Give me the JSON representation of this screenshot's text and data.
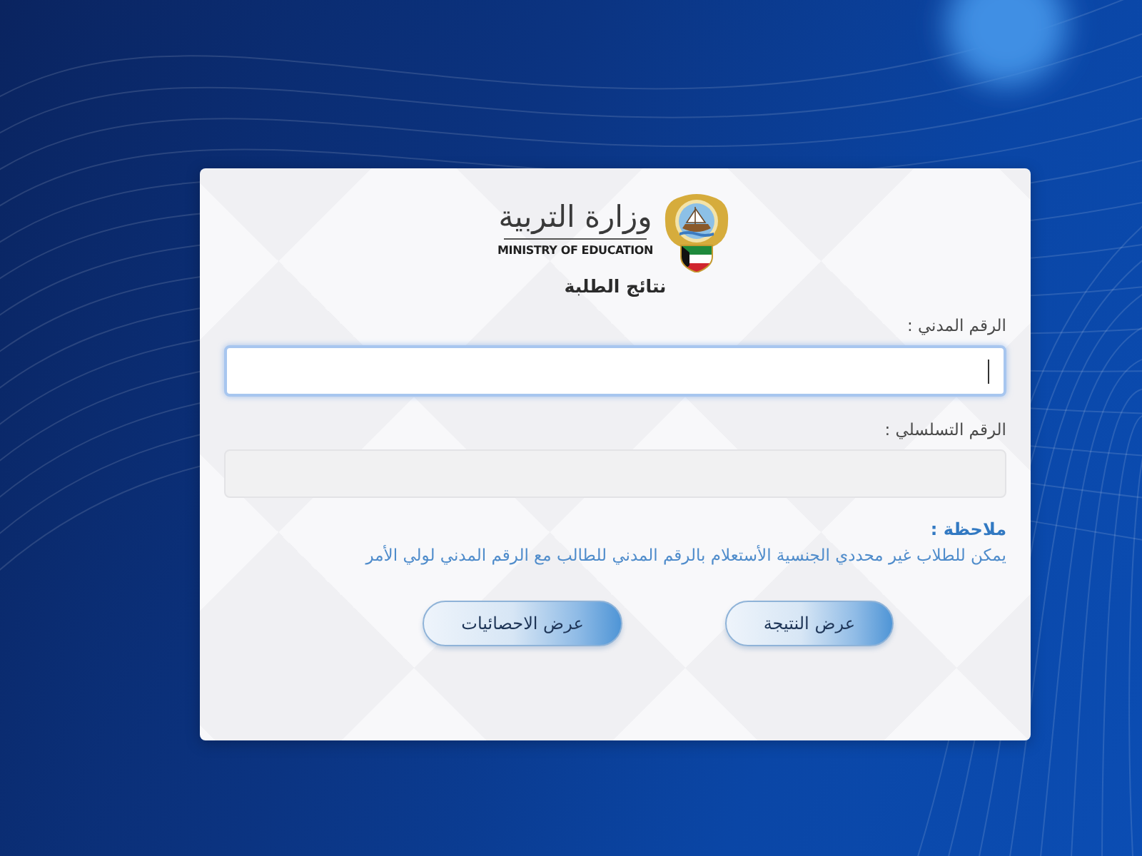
{
  "header": {
    "ministry_name_ar": "وزارة التربية",
    "ministry_name_en": "MINISTRY OF EDUCATION",
    "page_title": "نتائج الطلبة"
  },
  "fields": [
    {
      "label": "الرقم المدني :",
      "focused": true,
      "disabled": false
    },
    {
      "label": "الرقم التسلسلي :",
      "focused": false,
      "disabled": true
    }
  ],
  "note": {
    "heading": "ملاحظة :",
    "text": "يمكن للطلاب غير محددي الجنسية الأستعلام بالرقم المدني للطالب مع الرقم المدني لولي الأمر"
  },
  "buttons": [
    {
      "label": "عرض النتيجة"
    },
    {
      "label": "عرض الاحصائيات"
    }
  ]
}
